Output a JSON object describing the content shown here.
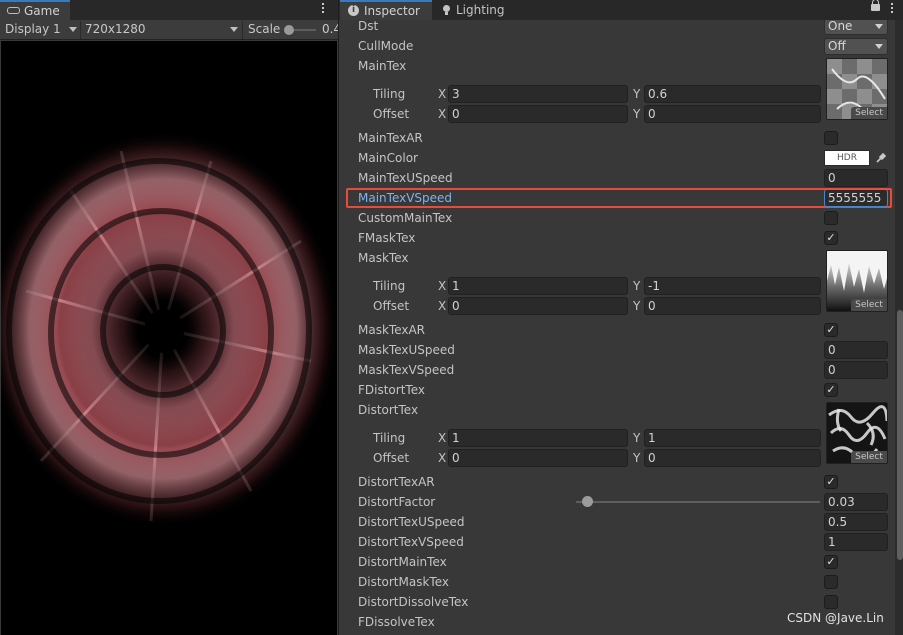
{
  "game": {
    "tab_label": "Game",
    "display_label": "Display 1",
    "resolution_label": "720x1280",
    "scale_label": "Scale",
    "scale_value_partial": "0.4"
  },
  "inspector": {
    "tab_label": "Inspector",
    "lighting_tab_label": "Lighting",
    "props": {
      "dst": {
        "label": "Dst",
        "value": "One"
      },
      "cullmode": {
        "label": "CullMode",
        "value": "Off"
      },
      "maintex": {
        "label": "MainTex",
        "tiling_label": "Tiling",
        "offset_label": "Offset",
        "tiling_x": "3",
        "tiling_y": "0.6",
        "offset_x": "0",
        "offset_y": "0",
        "select_label": "Select"
      },
      "maintexar": {
        "label": "MainTexAR",
        "checked": false
      },
      "maincolor": {
        "label": "MainColor",
        "swatch_text": "HDR"
      },
      "maintexuspeed": {
        "label": "MainTexUSpeed",
        "value": "0"
      },
      "maintexvspeed": {
        "label": "MainTexVSpeed",
        "value": "5555555"
      },
      "custommaintex": {
        "label": "CustomMainTex",
        "checked": false
      },
      "fmasktex": {
        "label": "FMaskTex",
        "checked": true
      },
      "masktex": {
        "label": "MaskTex",
        "tiling_label": "Tiling",
        "offset_label": "Offset",
        "tiling_x": "1",
        "tiling_y": "-1",
        "offset_x": "0",
        "offset_y": "0",
        "select_label": "Select"
      },
      "masktexar": {
        "label": "MaskTexAR",
        "checked": true
      },
      "masktexuspeed": {
        "label": "MaskTexUSpeed",
        "value": "0"
      },
      "masktexvspeed": {
        "label": "MaskTexVSpeed",
        "value": "0"
      },
      "fdistorttex": {
        "label": "FDistortTex",
        "checked": true
      },
      "distorttex": {
        "label": "DistortTex",
        "tiling_label": "Tiling",
        "offset_label": "Offset",
        "tiling_x": "1",
        "tiling_y": "1",
        "offset_x": "0",
        "offset_y": "0",
        "select_label": "Select"
      },
      "distorttexar": {
        "label": "DistortTexAR",
        "checked": true
      },
      "distortfactor": {
        "label": "DistortFactor",
        "value": "0.03"
      },
      "distorttexuspeed": {
        "label": "DistortTexUSpeed",
        "value": "0.5"
      },
      "distorttexvspeed": {
        "label": "DistortTexVSpeed",
        "value": "1"
      },
      "distortmaintex": {
        "label": "DistortMainTex",
        "checked": true
      },
      "distortmasktex": {
        "label": "DistortMaskTex",
        "checked": false
      },
      "distortdissolvetex": {
        "label": "DistortDissolveTex",
        "checked": false
      },
      "fdissolvetex": {
        "label": "FDissolveTex"
      }
    },
    "axis_x": "X",
    "axis_y": "Y",
    "check_glyph": "✓"
  },
  "watermark": "CSDN @Jave.Lin",
  "colors": {
    "accent_tab": "#3a79bb",
    "highlight_box": "#e84b3c",
    "selected_label": "#7fb2ef",
    "effect_tint": "#e07f86"
  }
}
